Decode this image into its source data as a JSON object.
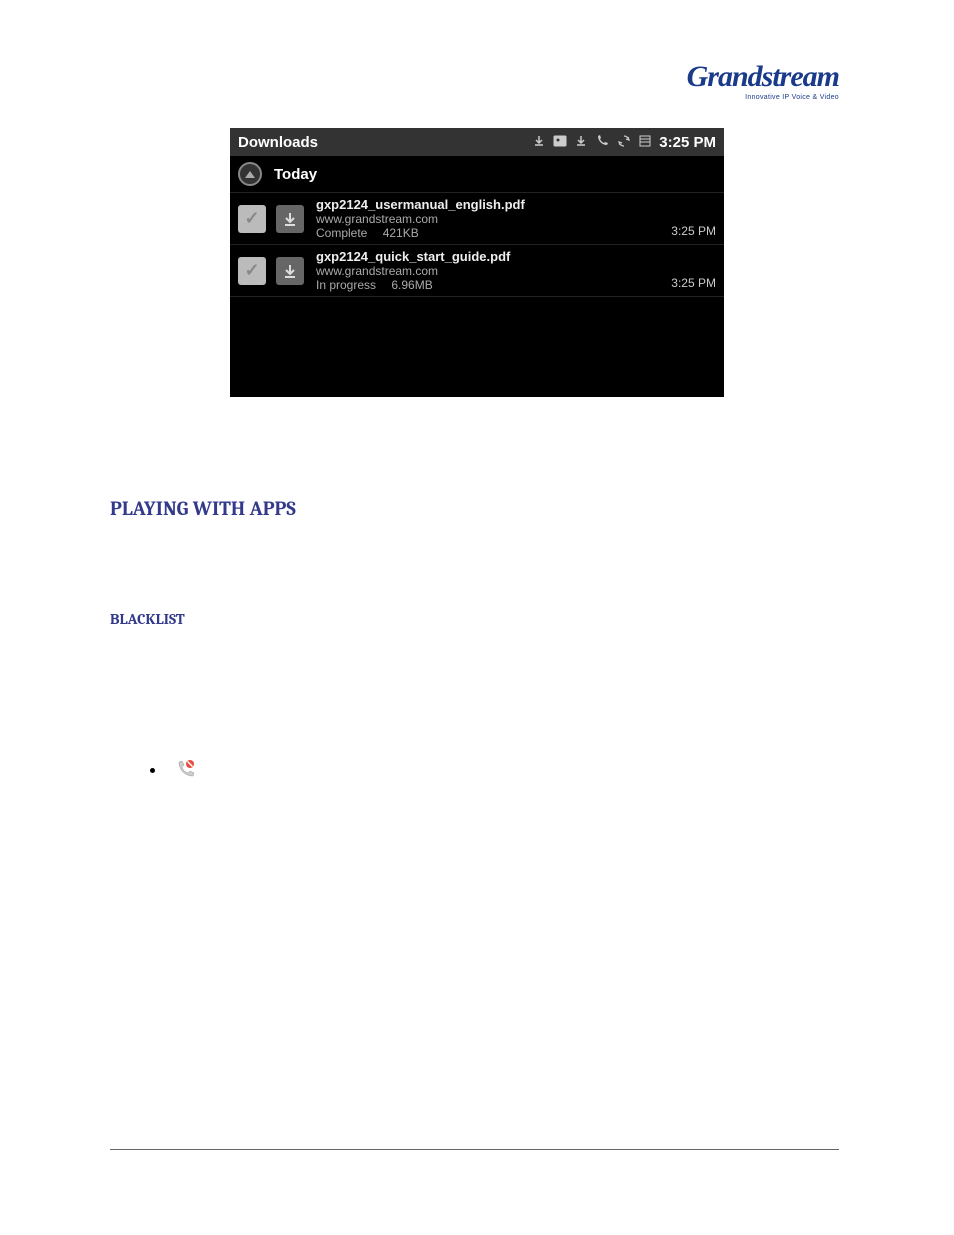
{
  "logo": {
    "brand": "Grandstream",
    "tagline": "Innovative IP Voice & Video"
  },
  "screenshot": {
    "title": "Downloads",
    "time": "3:25 PM",
    "section": "Today",
    "items": [
      {
        "filename": "gxp2124_usermanual_english.pdf",
        "source": "www.grandstream.com",
        "status": "Complete",
        "size": "421KB",
        "time": "3:25 PM"
      },
      {
        "filename": "gxp2124_quick_start_guide.pdf",
        "source": "www.grandstream.com",
        "status": "In progress",
        "size": "6.96MB",
        "time": "3:25 PM"
      }
    ]
  },
  "headings": {
    "h1": "PLAYING WITH APPS",
    "h2": "BLACKLIST"
  }
}
